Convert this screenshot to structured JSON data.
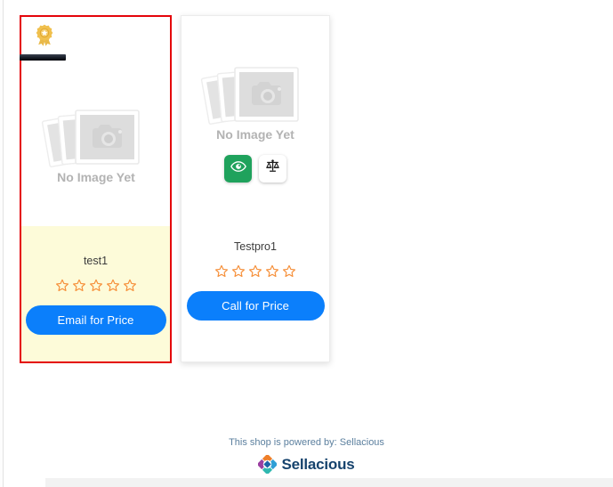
{
  "page": {
    "background_color": "#ffffff"
  },
  "products": [
    {
      "name": "test1",
      "featured": true,
      "featured_badge_icon": "award-ribbon-icon",
      "image_placeholder_text": "No Image Yet",
      "rating": 0,
      "max_rating": 5,
      "star_color": "#f6913c",
      "cta_label": "Email for Price",
      "cta_color": "#0b7ffb",
      "border_color": "#e4040a",
      "info_background": "#fdfbd9",
      "actions": []
    },
    {
      "name": "Testpro1",
      "featured": false,
      "image_placeholder_text": "No Image Yet",
      "rating": 0,
      "max_rating": 5,
      "star_color": "#f6913c",
      "cta_label": "Call for Price",
      "cta_color": "#0b7ffb",
      "border_color": "#ececec",
      "info_background": "#ffffff",
      "actions": [
        {
          "icon": "eye-icon",
          "name": "quick-view",
          "background": "#1fa25c"
        },
        {
          "icon": "scales-icon",
          "name": "compare",
          "background": "#ffffff"
        }
      ]
    }
  ],
  "footer": {
    "powered_by_text": "This shop is powered by: Sellacious",
    "logo_text": "Sellacious",
    "logo_icon": "sellacious-diamond-logo",
    "text_color": "#5b7f9e",
    "logo_text_color": "#16436d"
  }
}
